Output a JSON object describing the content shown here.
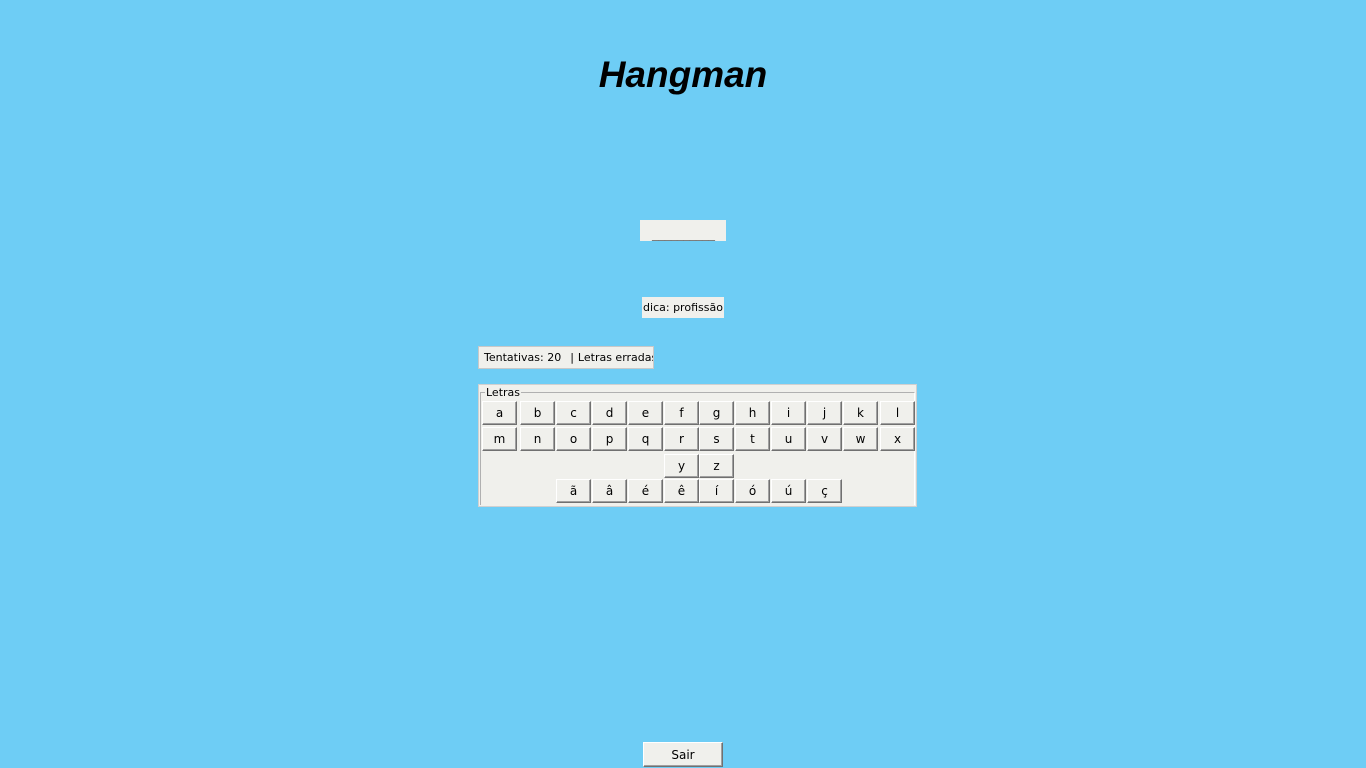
{
  "app": {
    "title": "Hangman",
    "background_color": "#6ecdf5"
  },
  "word": {
    "masked": "__________"
  },
  "hint": {
    "text": "dica: profissão"
  },
  "status": {
    "attempts_label": "Tentativas: 20",
    "separator": "|",
    "wrong_letters_label": "Letras erradas:"
  },
  "letters": {
    "legend": "Letras",
    "rows": [
      [
        "a",
        "b",
        "c",
        "d",
        "e",
        "f",
        "g",
        "h",
        "i",
        "j",
        "k",
        "l"
      ],
      [
        "m",
        "n",
        "o",
        "p",
        "q",
        "r",
        "s",
        "t",
        "u",
        "v",
        "w",
        "x"
      ],
      [
        "y",
        "z"
      ],
      [
        "ã",
        "â",
        "é",
        "ê",
        "í",
        "ó",
        "ú",
        "ç"
      ]
    ]
  },
  "footer": {
    "exit_label": "Sair"
  }
}
